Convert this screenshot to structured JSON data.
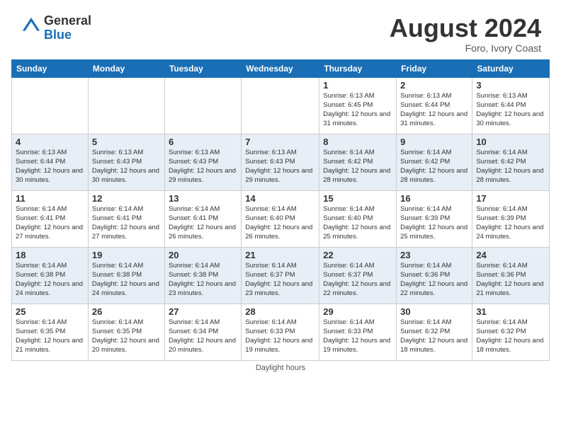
{
  "header": {
    "logo_general": "General",
    "logo_blue": "Blue",
    "month_title": "August 2024",
    "location": "Foro, Ivory Coast"
  },
  "days_of_week": [
    "Sunday",
    "Monday",
    "Tuesday",
    "Wednesday",
    "Thursday",
    "Friday",
    "Saturday"
  ],
  "weeks": [
    [
      {
        "day": "",
        "info": ""
      },
      {
        "day": "",
        "info": ""
      },
      {
        "day": "",
        "info": ""
      },
      {
        "day": "",
        "info": ""
      },
      {
        "day": "1",
        "info": "Sunrise: 6:13 AM\nSunset: 6:45 PM\nDaylight: 12 hours and 31 minutes."
      },
      {
        "day": "2",
        "info": "Sunrise: 6:13 AM\nSunset: 6:44 PM\nDaylight: 12 hours and 31 minutes."
      },
      {
        "day": "3",
        "info": "Sunrise: 6:13 AM\nSunset: 6:44 PM\nDaylight: 12 hours and 30 minutes."
      }
    ],
    [
      {
        "day": "4",
        "info": "Sunrise: 6:13 AM\nSunset: 6:44 PM\nDaylight: 12 hours and 30 minutes."
      },
      {
        "day": "5",
        "info": "Sunrise: 6:13 AM\nSunset: 6:43 PM\nDaylight: 12 hours and 30 minutes."
      },
      {
        "day": "6",
        "info": "Sunrise: 6:13 AM\nSunset: 6:43 PM\nDaylight: 12 hours and 29 minutes."
      },
      {
        "day": "7",
        "info": "Sunrise: 6:13 AM\nSunset: 6:43 PM\nDaylight: 12 hours and 29 minutes."
      },
      {
        "day": "8",
        "info": "Sunrise: 6:14 AM\nSunset: 6:42 PM\nDaylight: 12 hours and 28 minutes."
      },
      {
        "day": "9",
        "info": "Sunrise: 6:14 AM\nSunset: 6:42 PM\nDaylight: 12 hours and 28 minutes."
      },
      {
        "day": "10",
        "info": "Sunrise: 6:14 AM\nSunset: 6:42 PM\nDaylight: 12 hours and 28 minutes."
      }
    ],
    [
      {
        "day": "11",
        "info": "Sunrise: 6:14 AM\nSunset: 6:41 PM\nDaylight: 12 hours and 27 minutes."
      },
      {
        "day": "12",
        "info": "Sunrise: 6:14 AM\nSunset: 6:41 PM\nDaylight: 12 hours and 27 minutes."
      },
      {
        "day": "13",
        "info": "Sunrise: 6:14 AM\nSunset: 6:41 PM\nDaylight: 12 hours and 26 minutes."
      },
      {
        "day": "14",
        "info": "Sunrise: 6:14 AM\nSunset: 6:40 PM\nDaylight: 12 hours and 26 minutes."
      },
      {
        "day": "15",
        "info": "Sunrise: 6:14 AM\nSunset: 6:40 PM\nDaylight: 12 hours and 25 minutes."
      },
      {
        "day": "16",
        "info": "Sunrise: 6:14 AM\nSunset: 6:39 PM\nDaylight: 12 hours and 25 minutes."
      },
      {
        "day": "17",
        "info": "Sunrise: 6:14 AM\nSunset: 6:39 PM\nDaylight: 12 hours and 24 minutes."
      }
    ],
    [
      {
        "day": "18",
        "info": "Sunrise: 6:14 AM\nSunset: 6:38 PM\nDaylight: 12 hours and 24 minutes."
      },
      {
        "day": "19",
        "info": "Sunrise: 6:14 AM\nSunset: 6:38 PM\nDaylight: 12 hours and 24 minutes."
      },
      {
        "day": "20",
        "info": "Sunrise: 6:14 AM\nSunset: 6:38 PM\nDaylight: 12 hours and 23 minutes."
      },
      {
        "day": "21",
        "info": "Sunrise: 6:14 AM\nSunset: 6:37 PM\nDaylight: 12 hours and 23 minutes."
      },
      {
        "day": "22",
        "info": "Sunrise: 6:14 AM\nSunset: 6:37 PM\nDaylight: 12 hours and 22 minutes."
      },
      {
        "day": "23",
        "info": "Sunrise: 6:14 AM\nSunset: 6:36 PM\nDaylight: 12 hours and 22 minutes."
      },
      {
        "day": "24",
        "info": "Sunrise: 6:14 AM\nSunset: 6:36 PM\nDaylight: 12 hours and 21 minutes."
      }
    ],
    [
      {
        "day": "25",
        "info": "Sunrise: 6:14 AM\nSunset: 6:35 PM\nDaylight: 12 hours and 21 minutes."
      },
      {
        "day": "26",
        "info": "Sunrise: 6:14 AM\nSunset: 6:35 PM\nDaylight: 12 hours and 20 minutes."
      },
      {
        "day": "27",
        "info": "Sunrise: 6:14 AM\nSunset: 6:34 PM\nDaylight: 12 hours and 20 minutes."
      },
      {
        "day": "28",
        "info": "Sunrise: 6:14 AM\nSunset: 6:33 PM\nDaylight: 12 hours and 19 minutes."
      },
      {
        "day": "29",
        "info": "Sunrise: 6:14 AM\nSunset: 6:33 PM\nDaylight: 12 hours and 19 minutes."
      },
      {
        "day": "30",
        "info": "Sunrise: 6:14 AM\nSunset: 6:32 PM\nDaylight: 12 hours and 18 minutes."
      },
      {
        "day": "31",
        "info": "Sunrise: 6:14 AM\nSunset: 6:32 PM\nDaylight: 12 hours and 18 minutes."
      }
    ]
  ],
  "footer": {
    "daylight_label": "Daylight hours"
  }
}
